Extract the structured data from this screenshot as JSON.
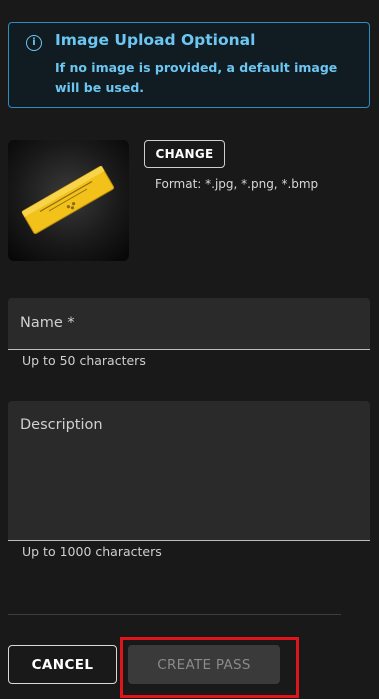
{
  "info": {
    "icon": "info-icon",
    "title": "Image Upload Optional",
    "message": "If no image is provided, a default image will be used.",
    "accent_color": "#6cc6f2"
  },
  "image": {
    "alt": "golden pass ticket",
    "change_label": "CHANGE",
    "format_text": "Format: *.jpg, *.png, *.bmp"
  },
  "name_field": {
    "label": "Name *",
    "value": "",
    "helper": "Up to 50 characters"
  },
  "description_field": {
    "label": "Description",
    "value": "",
    "helper": "Up to 1000 characters"
  },
  "actions": {
    "cancel_label": "CANCEL",
    "create_label": "CREATE PASS",
    "highlight_color": "#e0141b"
  }
}
